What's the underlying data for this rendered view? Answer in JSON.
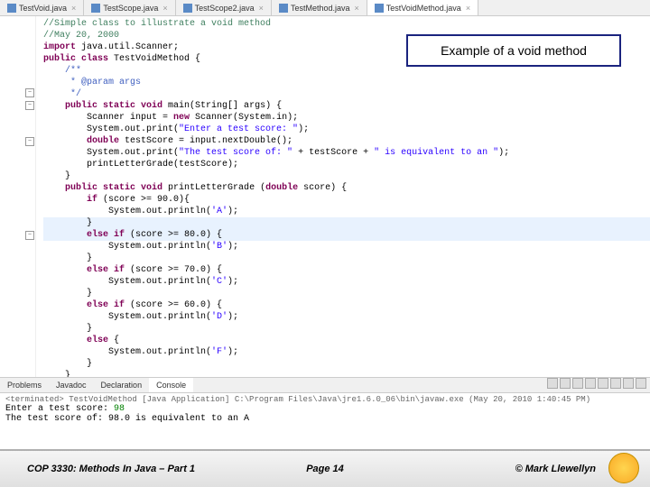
{
  "tabs": [
    {
      "label": "TestVoid.java"
    },
    {
      "label": "TestScope.java"
    },
    {
      "label": "TestScope2.java"
    },
    {
      "label": "TestMethod.java"
    },
    {
      "label": "TestVoidMethod.java"
    }
  ],
  "callout": {
    "text": "Example of a void method"
  },
  "code": {
    "l1": "//Simple class to illustrate a void method",
    "l2": "//May 20, 2000",
    "l3": "",
    "l4_kw": "import",
    "l4_rest": " java.util.Scanner;",
    "l5": "",
    "l6_kw": "public class",
    "l6_rest": " TestVoidMethod {",
    "l7": "",
    "l8": "    /**",
    "l9": "     * @param args",
    "l10": "     */",
    "l11_pre": "    ",
    "l11_kw": "public static void",
    "l11_rest": " main(String[] args) {",
    "l12_pre": "        Scanner input = ",
    "l12_kw": "new",
    "l12_rest": " Scanner(System.in);",
    "l13_pre": "        System.out.print(",
    "l13_str": "\"Enter a test score: \"",
    "l13_end": ");",
    "l14_pre": "        ",
    "l14_kw": "double",
    "l14_rest": " testScore = input.nextDouble();",
    "l15_pre": "        System.out.print(",
    "l15_str": "\"The test score of: \"",
    "l15_mid": " + testScore + ",
    "l15_str2": "\" is equivalent to an \"",
    "l15_end": ");",
    "l16": "        printLetterGrade(testScore);",
    "l17": "    }",
    "l18": "",
    "l19_pre": "    ",
    "l19_kw": "public static void",
    "l19_rest": " printLetterGrade (",
    "l19_kw2": "double",
    "l19_rest2": " score) {",
    "l20_pre": "        ",
    "l20_kw": "if",
    "l20_rest": " (score >= 90.0){",
    "l21_pre": "            System.out.println(",
    "l21_str": "'A'",
    "l21_end": ");",
    "l22": "        }",
    "l23_pre": "        ",
    "l23_kw": "else if",
    "l23_rest": " (score >= 80.0) {",
    "l24_pre": "            System.out.println(",
    "l24_str": "'B'",
    "l24_end": ");",
    "l25": "        }",
    "l26_pre": "        ",
    "l26_kw": "else if",
    "l26_rest": " (score >= 70.0) {",
    "l27_pre": "            System.out.println(",
    "l27_str": "'C'",
    "l27_end": ");",
    "l28": "        }",
    "l29_pre": "        ",
    "l29_kw": "else if",
    "l29_rest": " (score >= 60.0) {",
    "l30_pre": "            System.out.println(",
    "l30_str": "'D'",
    "l30_end": ");",
    "l31": "        }",
    "l32_pre": "        ",
    "l32_kw": "else",
    "l32_rest": " {",
    "l33_pre": "            System.out.println(",
    "l33_str": "'F'",
    "l33_end": ");",
    "l34": "        }",
    "l35": "    }",
    "l36": "}"
  },
  "bottom_tabs": [
    {
      "label": "Problems"
    },
    {
      "label": "Javadoc"
    },
    {
      "label": "Declaration"
    },
    {
      "label": "Console"
    }
  ],
  "console": {
    "header": "<terminated> TestVoidMethod [Java Application] C:\\Program Files\\Java\\jre1.6.0_06\\bin\\javaw.exe (May 20, 2010 1:40:45 PM)",
    "line1_pre": "Enter a test score: ",
    "line1_val": "98",
    "line2": "The test score of: 98.0 is equivalent to an A"
  },
  "footer": {
    "left": "COP 3330:  Methods In Java – Part 1",
    "center": "Page 14",
    "right": "© Mark Llewellyn"
  }
}
